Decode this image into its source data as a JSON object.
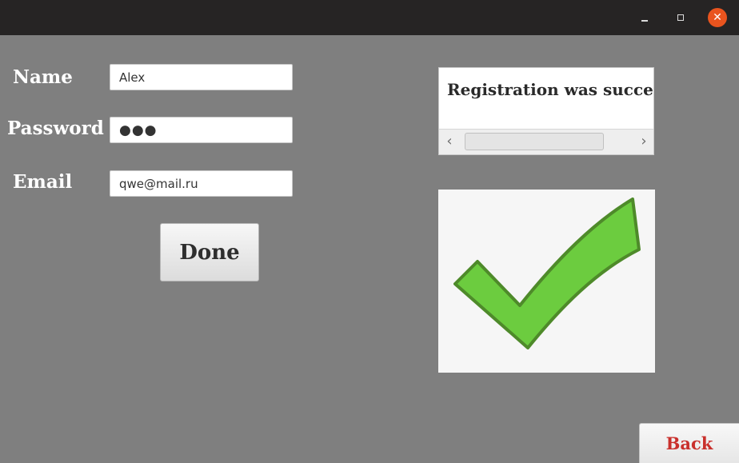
{
  "window": {
    "controls": {
      "minimize_icon": "minimize-icon",
      "maximize_icon": "maximize-icon",
      "close_icon": "close-icon",
      "close_glyph": "✕",
      "close_color": "#e9541e"
    }
  },
  "form": {
    "name_label": "Name",
    "name_value": "Alex",
    "password_label": "Password",
    "password_value": "●●●",
    "email_label": "Email",
    "email_value": "qwe@mail.ru",
    "done_label": "Done"
  },
  "result": {
    "message": "Registration was successful",
    "scroll_left": "‹",
    "scroll_right": "›",
    "image_icon": "checkmark-icon",
    "check_color": "#6ccc3f"
  },
  "footer": {
    "back_label": "Back",
    "back_color": "#c9302c"
  }
}
